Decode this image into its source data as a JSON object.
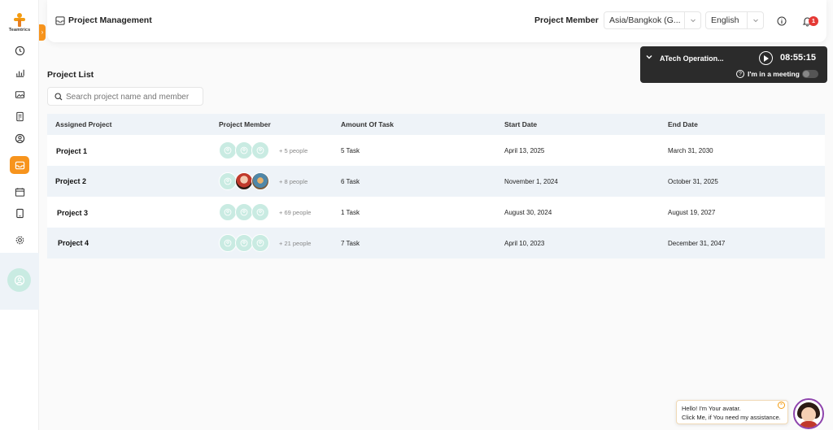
{
  "brand": {
    "name": "Teamtrics"
  },
  "header": {
    "title": "Project Management",
    "member_label": "Project Member",
    "timezone": "Asia/Bangkok (G...",
    "language": "English",
    "notifications": "1"
  },
  "timer": {
    "name": "ATech Operation...",
    "time": "08:55:15",
    "meeting_label": "I'm in a meeting"
  },
  "project_list": {
    "title": "Project List",
    "search_placeholder": "Search project name and member",
    "columns": [
      "Assigned Project",
      "Project Member",
      "Amount Of Task",
      "Start Date",
      "End Date"
    ],
    "rows": [
      {
        "name": "Project 1",
        "members_more": "+ 5 people",
        "tasks": "5 Task",
        "start": "April 13, 2025",
        "end": "March 31, 2030"
      },
      {
        "name": "Project 2",
        "members_more": "+ 8 people",
        "tasks": "6 Task",
        "start": "November 1, 2024",
        "end": "October 31, 2025"
      },
      {
        "name": "Project 3",
        "members_more": "+ 69 people",
        "tasks": "1 Task",
        "start": "August 30, 2024",
        "end": "August 19, 2027"
      },
      {
        "name": "Project 4",
        "members_more": "+ 21 people",
        "tasks": "7 Task",
        "start": "April 10, 2023",
        "end": "December 31, 2047"
      }
    ]
  },
  "assistant": {
    "line1": "Hello! I'm Your avatar.",
    "line2": "Click Me, if You need my assistance."
  },
  "colors": {
    "accent": "#f7941d",
    "row_alt": "#eef3f8",
    "timer_bg": "#2b2b2b",
    "badge": "#e53935"
  }
}
